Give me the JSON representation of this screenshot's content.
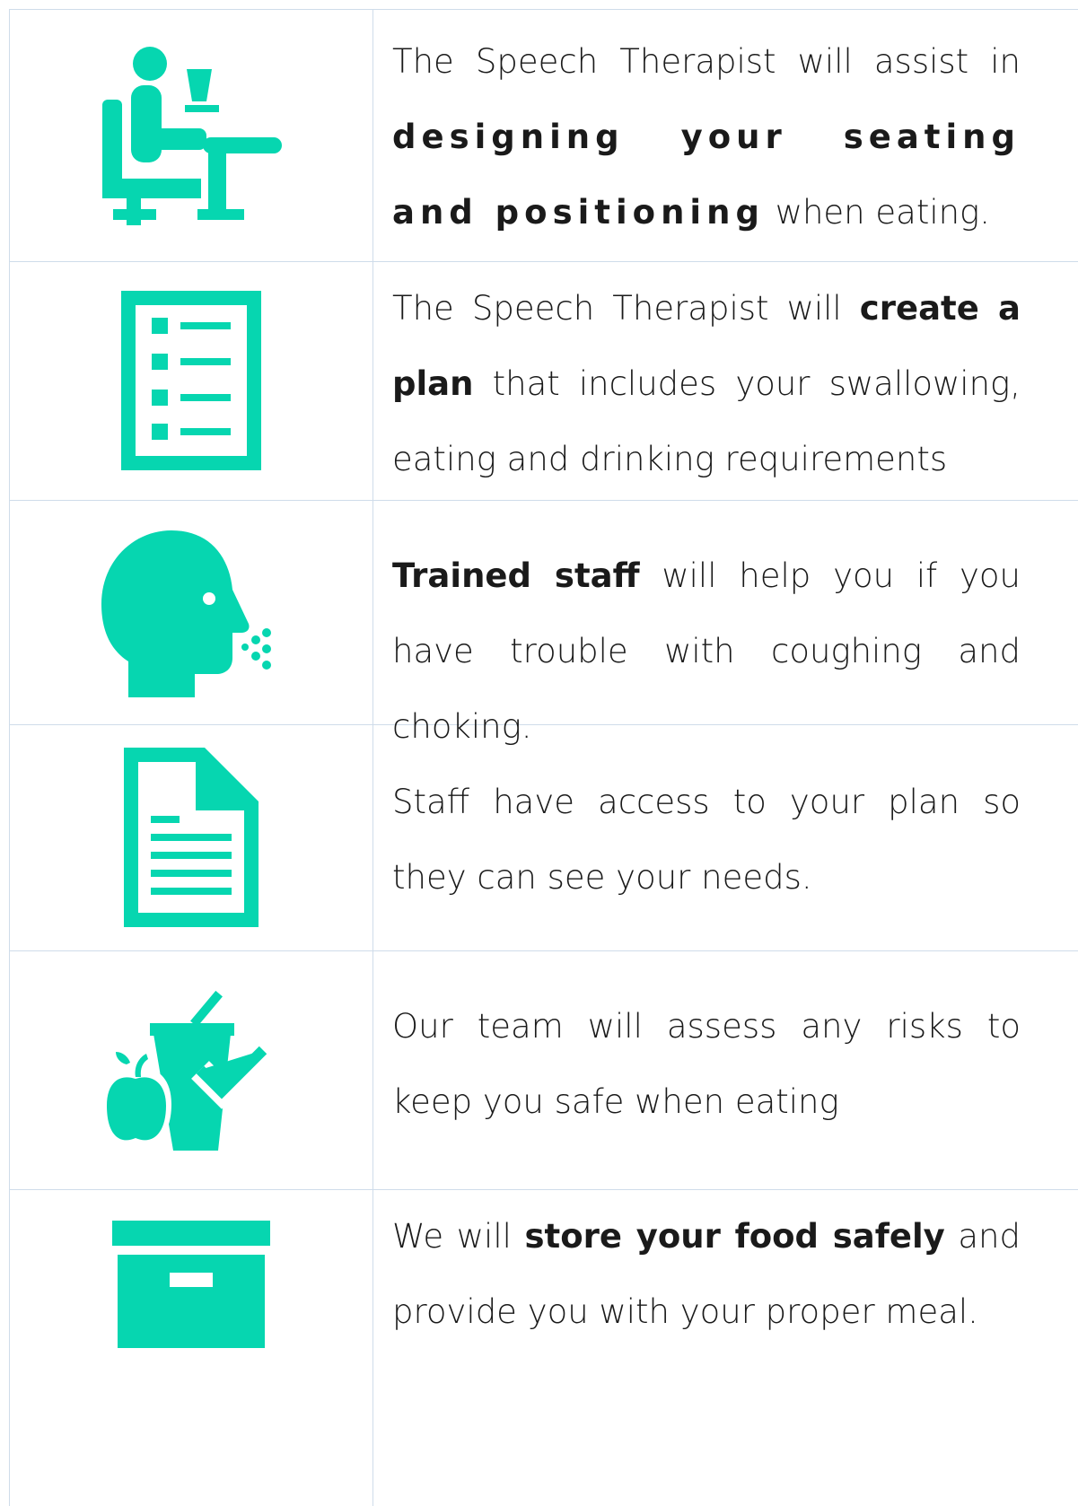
{
  "accent_color": "#06d6b0",
  "rows": [
    {
      "icon": "person-seated-at-table-icon",
      "parts": [
        "The Speech Therapist will assist in ",
        "designing your seating and positioning",
        " when eating."
      ]
    },
    {
      "icon": "checklist-icon",
      "parts": [
        "The Speech Therapist will ",
        "create a plan",
        " that includes your swallowing, eating and drinking requirements"
      ]
    },
    {
      "icon": "coughing-head-icon",
      "parts": [
        "",
        "Trained staff",
        " will help you if you have trouble with coughing and choking."
      ]
    },
    {
      "icon": "document-icon",
      "parts": [
        "Staff have access to your plan so they can see your needs."
      ]
    },
    {
      "icon": "food-drink-check-icon",
      "parts": [
        "Our team will assess any risks to keep you safe when eating"
      ]
    },
    {
      "icon": "storage-box-icon",
      "parts": [
        "We will ",
        "store your food safely",
        " and provide you with your proper meal."
      ]
    }
  ]
}
